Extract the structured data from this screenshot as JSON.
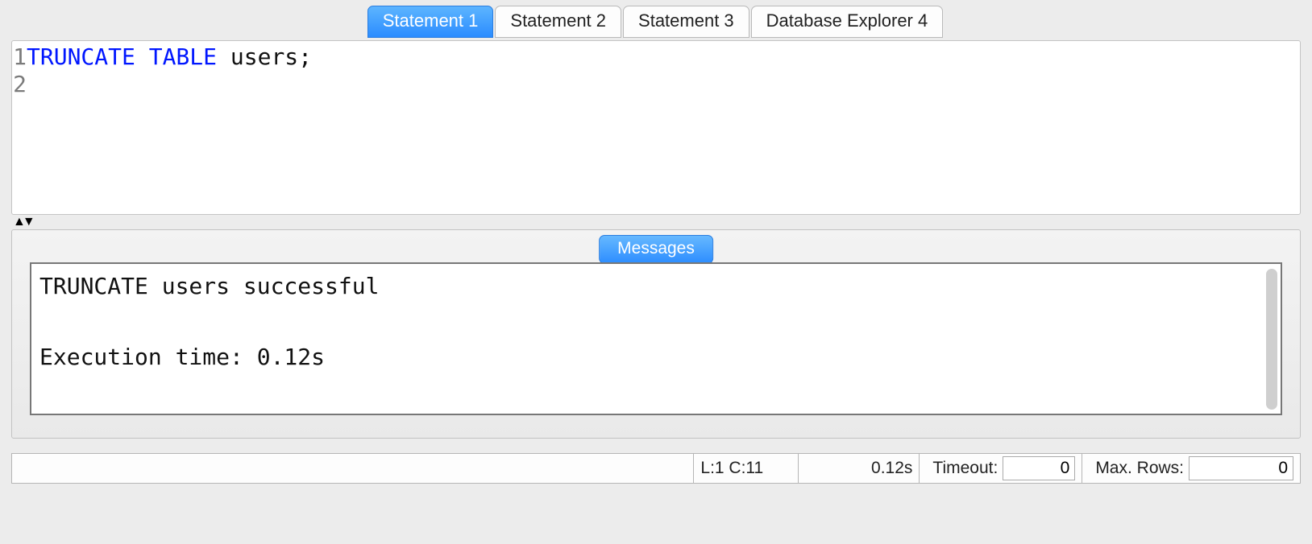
{
  "tabs": {
    "items": [
      {
        "label": "Statement 1",
        "active": true
      },
      {
        "label": "Statement 2",
        "active": false
      },
      {
        "label": "Statement 3",
        "active": false
      },
      {
        "label": "Database Explorer 4",
        "active": false
      }
    ]
  },
  "editor": {
    "line_numbers": [
      "1",
      "2"
    ],
    "code_keyword_1": "TRUNCATE",
    "code_keyword_2": "TABLE",
    "code_rest": " users;"
  },
  "messages": {
    "tab_label": "Messages",
    "text": "TRUNCATE users successful\n\nExecution time: 0.12s"
  },
  "statusbar": {
    "cursor_pos": "L:1 C:11",
    "exec_time": "0.12s",
    "timeout_label": "Timeout:",
    "timeout_value": "0",
    "maxrows_label": "Max. Rows:",
    "maxrows_value": "0"
  }
}
